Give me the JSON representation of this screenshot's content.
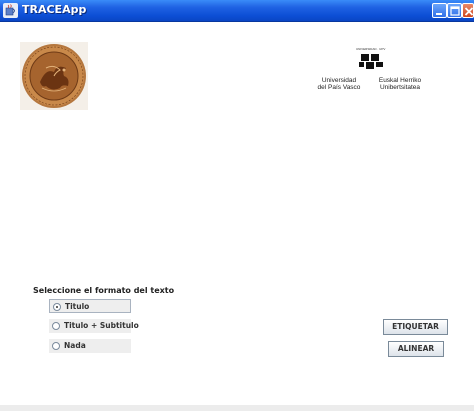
{
  "window": {
    "title": "TRACEApp",
    "icon": "java-cup-icon",
    "controls": [
      "minimize-icon",
      "maximize-icon",
      "close-icon"
    ]
  },
  "logos": {
    "seal": "seal-logo",
    "university": {
      "small_text": "UNIVERSIDAD · UPV",
      "spanish": "Universidad\ndel País Vasco",
      "basque": "Euskal Herriko\nUnibertsitatea"
    }
  },
  "format": {
    "label": "Seleccione el formato del texto",
    "options": [
      {
        "label": "Titulo",
        "selected": true
      },
      {
        "label": "Titulo + Subtitulo",
        "selected": false
      },
      {
        "label": "Nada",
        "selected": false
      }
    ]
  },
  "buttons": {
    "etiquetar": "ETIQUETAR",
    "alinear": "ALINEAR"
  }
}
